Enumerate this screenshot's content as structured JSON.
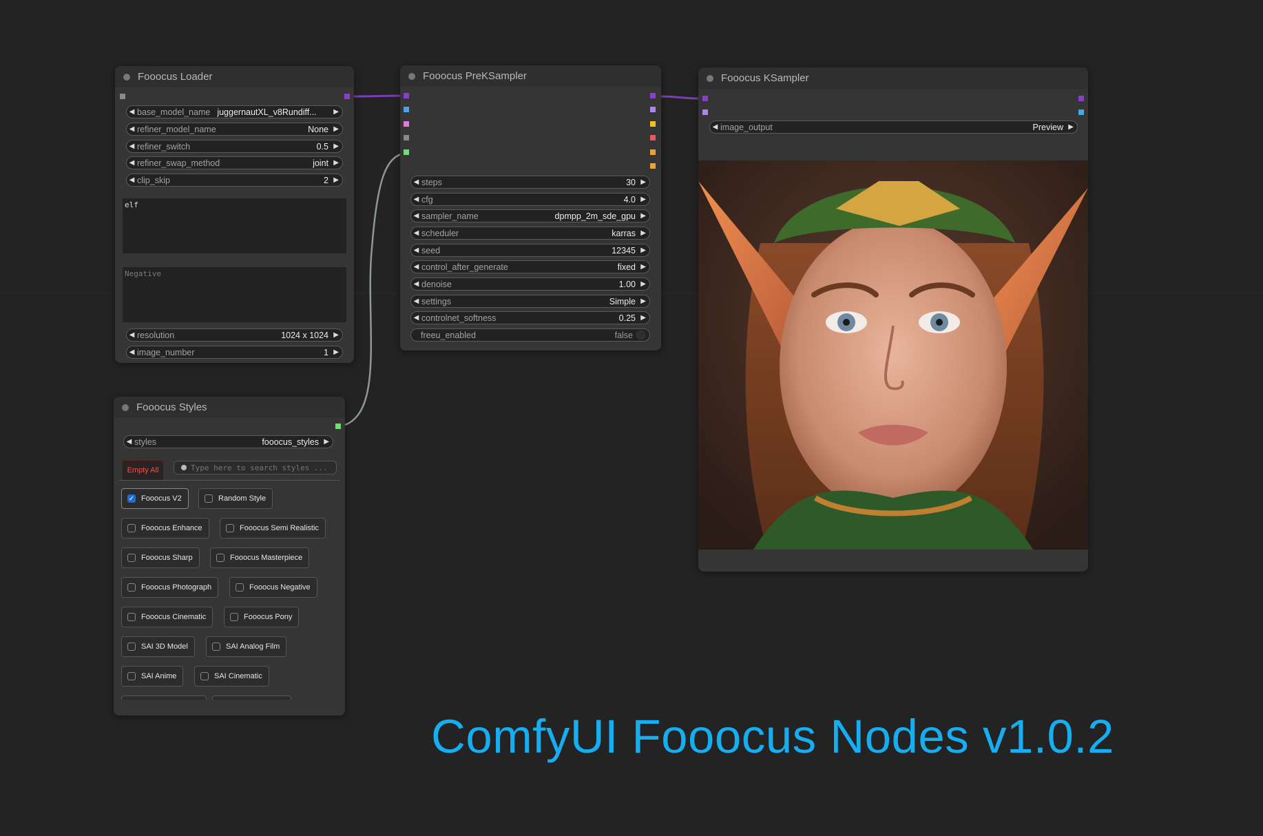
{
  "loader": {
    "title": "Fooocus Loader",
    "widgets": [
      {
        "label": "base_model_name",
        "value": "juggernautXL_v8Rundiff..."
      },
      {
        "label": "refiner_model_name",
        "value": "None"
      },
      {
        "label": "refiner_switch",
        "value": "0.5"
      },
      {
        "label": "refiner_swap_method",
        "value": "joint"
      },
      {
        "label": "clip_skip",
        "value": "2"
      }
    ],
    "positive_prompt": "elf",
    "negative_placeholder": "Negative",
    "bottom_widgets": [
      {
        "label": "resolution",
        "value": "1024 x 1024"
      },
      {
        "label": "image_number",
        "value": "1"
      }
    ]
  },
  "preksampler": {
    "title": "Fooocus PreKSampler",
    "widgets": [
      {
        "label": "steps",
        "value": "30"
      },
      {
        "label": "cfg",
        "value": "4.0"
      },
      {
        "label": "sampler_name",
        "value": "dpmpp_2m_sde_gpu"
      },
      {
        "label": "scheduler",
        "value": "karras"
      },
      {
        "label": "seed",
        "value": "12345"
      },
      {
        "label": "control_after_generate",
        "value": "fixed"
      },
      {
        "label": "denoise",
        "value": "1.00"
      },
      {
        "label": "settings",
        "value": "Simple"
      },
      {
        "label": "controlnet_softness",
        "value": "0.25"
      }
    ],
    "toggle": {
      "label": "freeu_enabled",
      "value": "false"
    }
  },
  "ksampler": {
    "title": "Fooocus KSampler",
    "widget": {
      "label": "image_output",
      "value": "Preview"
    }
  },
  "styles": {
    "title": "Fooocus Styles",
    "widget": {
      "label": "styles",
      "value": "fooocus_styles"
    },
    "empty_all_label": "Empty All",
    "search_placeholder": "Type here to search styles ...",
    "rows": [
      [
        {
          "label": "Fooocus V2",
          "checked": true
        },
        {
          "label": "Random Style",
          "checked": false
        }
      ],
      [
        {
          "label": "Fooocus Enhance",
          "checked": false
        },
        {
          "label": "Fooocus Semi Realistic",
          "checked": false
        }
      ],
      [
        {
          "label": "Fooocus Sharp",
          "checked": false
        },
        {
          "label": "Fooocus Masterpiece",
          "checked": false
        }
      ],
      [
        {
          "label": "Fooocus Photograph",
          "checked": false
        },
        {
          "label": "Fooocus Negative",
          "checked": false
        }
      ],
      [
        {
          "label": "Fooocus Cinematic",
          "checked": false
        },
        {
          "label": "Fooocus Pony",
          "checked": false
        }
      ],
      [
        {
          "label": "SAI 3D Model",
          "checked": false
        },
        {
          "label": "SAI Analog Film",
          "checked": false
        }
      ],
      [
        {
          "label": "SAI Anime",
          "checked": false
        },
        {
          "label": "SAI Cinematic",
          "checked": false
        }
      ]
    ]
  },
  "banner": {
    "title": "ComfyUI Fooocus Nodes v1.0.2",
    "color": "#16aef0"
  },
  "colors": {
    "link_model": "#7b3fb3",
    "link_clip": "#8d8d8d",
    "slot_purple": "#8a3fcc",
    "slot_blue": "#49a6e6",
    "slot_pink": "#e07bd8",
    "slot_gray": "#8a8a8a",
    "slot_green": "#6ee06e",
    "slot_lilac": "#a889e8",
    "slot_yellow": "#f2c21b",
    "slot_red": "#e85b5b",
    "slot_orange": "#f0a030"
  }
}
